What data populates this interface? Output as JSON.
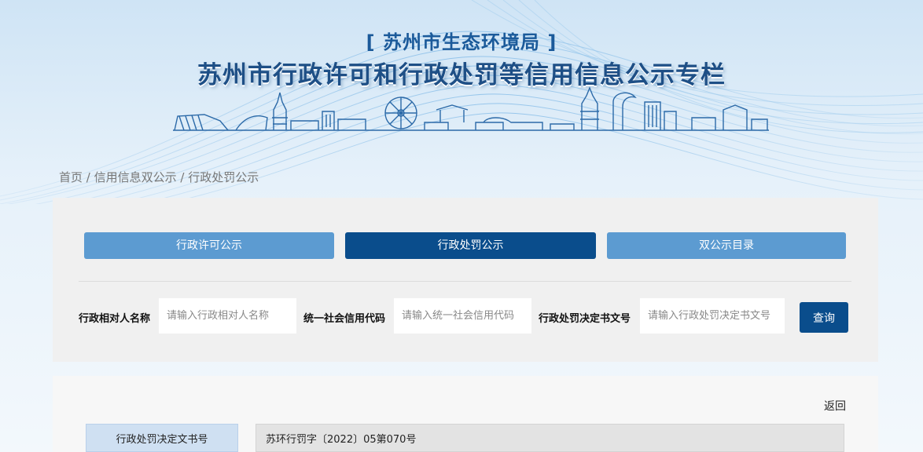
{
  "header": {
    "agency": "[ 苏州市生态环境局 ]",
    "title": "苏州市行政许可和行政处罚等信用信息公示专栏"
  },
  "breadcrumb": {
    "home": "首页",
    "separator": " / ",
    "level2": "信用信息双公示",
    "level3": "行政处罚公示"
  },
  "tabs": [
    {
      "label": "行政许可公示",
      "active": false
    },
    {
      "label": "行政处罚公示",
      "active": true
    },
    {
      "label": "双公示目录",
      "active": false
    }
  ],
  "search": {
    "name_label": "行政相对人名称",
    "name_placeholder": "请输入行政相对人名称",
    "code_label": "统一社会信用代码",
    "code_placeholder": "请输入统一社会信用代码",
    "doc_label": "行政处罚决定书文号",
    "doc_placeholder": "请输入行政处罚决定书文号",
    "query_label": "查询"
  },
  "detail": {
    "back_label": "返回",
    "field_label": "行政处罚决定文书号",
    "field_value": "苏环行罚字〔2022〕05第070号"
  },
  "colors": {
    "primary": "#0a4d8c",
    "tab_inactive": "#5c9bd1",
    "title": "#1e4f86"
  }
}
